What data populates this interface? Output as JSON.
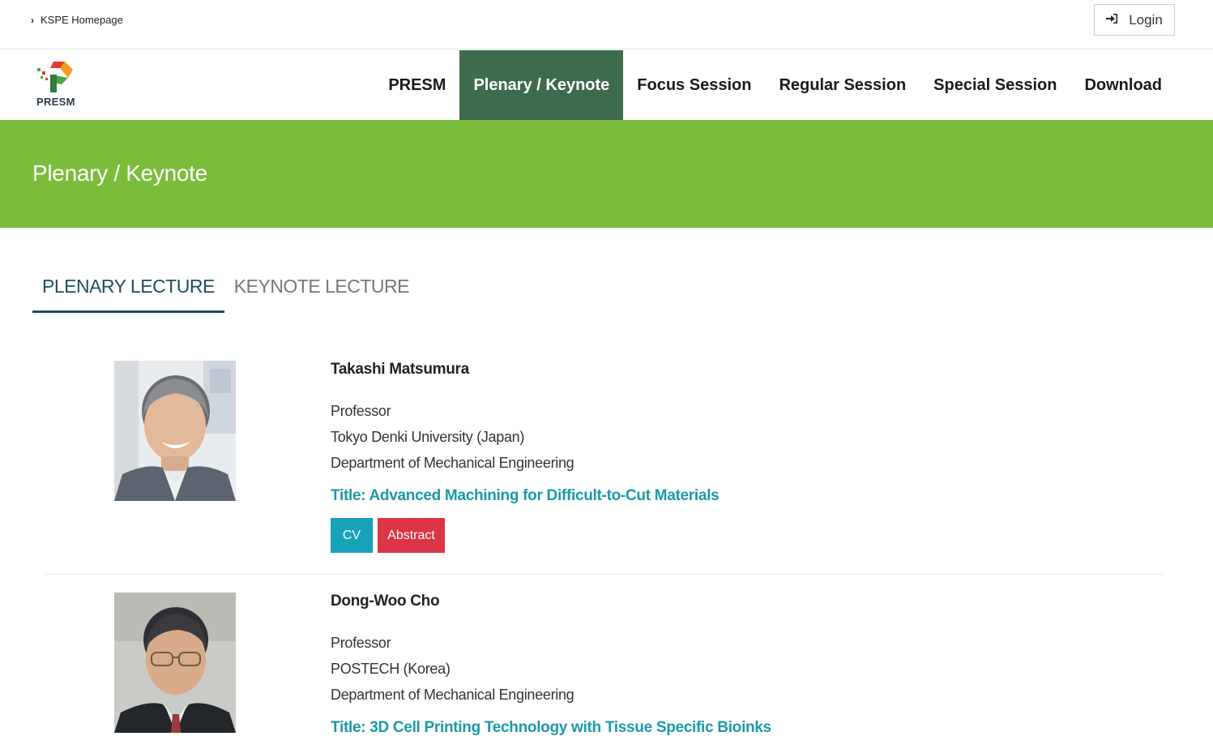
{
  "topbar": {
    "home_link": "KSPE Homepage",
    "login_label": "Login"
  },
  "logo": {
    "text": "PRESM"
  },
  "nav": {
    "items": [
      {
        "label": "PRESM"
      },
      {
        "label": "Plenary / Keynote",
        "active": true
      },
      {
        "label": "Focus Session"
      },
      {
        "label": "Regular Session"
      },
      {
        "label": "Special Session"
      },
      {
        "label": "Download"
      }
    ]
  },
  "banner": {
    "title": "Plenary / Keynote"
  },
  "tabs": [
    {
      "label": "PLENARY LECTURE",
      "active": true
    },
    {
      "label": "KEYNOTE LECTURE",
      "active": false
    }
  ],
  "speakers": [
    {
      "name": "Takashi Matsumura",
      "position": "Professor",
      "affiliation": "Tokyo Denki University (Japan)",
      "department": "Department of Mechanical Engineering",
      "title": "Title: Advanced Machining for Difficult-to-Cut Materials",
      "cv_label": "CV",
      "abstract_label": "Abstract"
    },
    {
      "name": "Dong-Woo Cho",
      "position": "Professor",
      "affiliation": "POSTECH (Korea)",
      "department": "Department of Mechanical Engineering",
      "title": "Title: 3D Cell Printing Technology with Tissue Specific Bioinks"
    }
  ],
  "colors": {
    "banner_green": "#7bbd3b",
    "nav_active": "#3e6b4c",
    "tab_active": "#1f4e5f",
    "title_teal": "#1b9aa8",
    "cv_button": "#17a2b8",
    "abstract_button": "#dc3545"
  }
}
